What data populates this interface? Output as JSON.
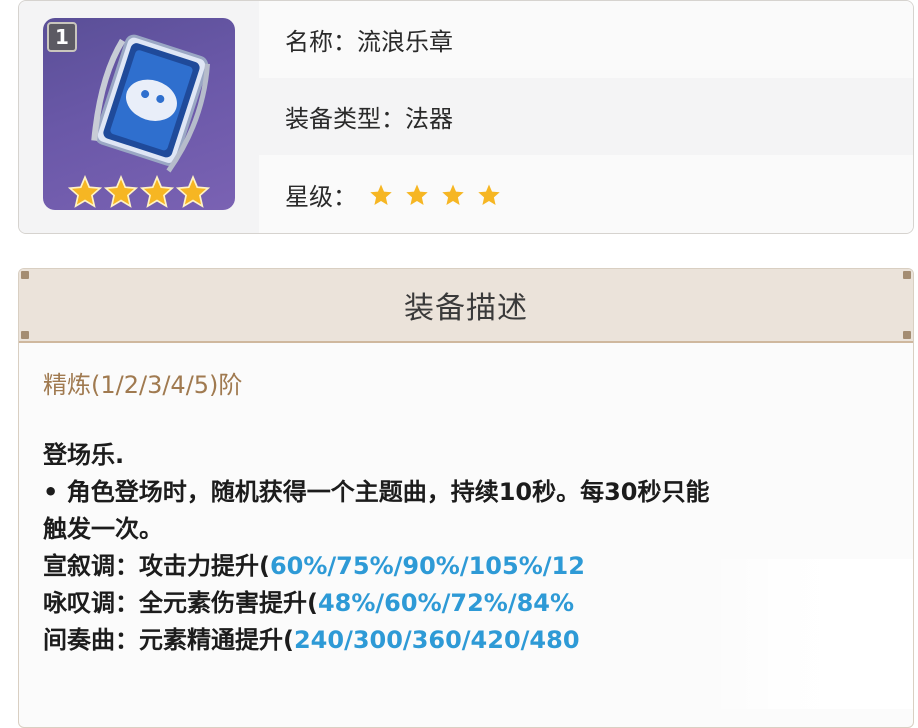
{
  "icon": {
    "refine_level": "1",
    "stars": 4,
    "art": "weapon-catalyst-icon"
  },
  "info": {
    "name_label": "名称：",
    "name_value": "流浪乐章",
    "type_label": "装备类型：",
    "type_value": "法器",
    "star_label": "星级：",
    "star_count": 4
  },
  "description": {
    "header": "装备描述",
    "refine_text": "精炼(1/2/3/4/5)阶",
    "title": "登场乐.",
    "line1": "• 角色登场时，随机获得一个主题曲，持续10秒。每30秒只能",
    "line2": "触发一次。",
    "effects": [
      {
        "prefix": "宣叙调：攻击力提升(",
        "values": "60%/75%/90%/105%/12"
      },
      {
        "prefix": "咏叹调：全元素伤害提升(",
        "values": "48%/60%/72%/84%"
      },
      {
        "prefix": "间奏曲：元素精通提升(",
        "values": "240/300/360/420/480"
      }
    ]
  },
  "colors": {
    "star": "#f6b623",
    "value_blue": "#2e9ad6",
    "refine_brown": "#a07a50"
  }
}
